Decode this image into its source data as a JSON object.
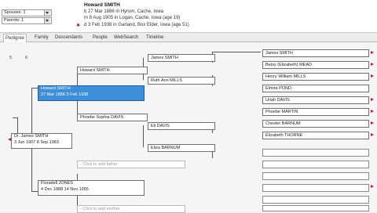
{
  "header": {
    "dropdowns": [
      "Spouses: 1",
      "Parents: 1"
    ],
    "person_name": "Howard SMITH",
    "facts": [
      "b 27 Mar 1886 in Hyrum, Cache, Iowa",
      "m 8 Aug 1905 in Logan, Cache, Iowa (age 19)",
      "d 3 Feb 1938 in Garland, Box Elder, Iowa (age 51)"
    ]
  },
  "tabs": [
    "Pedigree",
    "Family",
    "Descendants",
    "People",
    "WebSearch",
    "Timeline"
  ],
  "nav": {
    "a": "5",
    "b": "6"
  },
  "tree": {
    "focus": {
      "name": "Howard SMITH",
      "dates": "27 Mar 1886   3 Feb 1938"
    },
    "child": {
      "name": "Dr. James SMITH",
      "dates": "3 Jun 1907   8 Sep 1983"
    },
    "spouse": {
      "name": "Floradell JONES",
      "dates": "4 Dec 1888   14 Nov 1955"
    },
    "father": "Howard SMITH",
    "mother": "Phoebe Sophia DAVIS",
    "gp": [
      "James SMITH",
      "Ruth Ann MILLS",
      "Eli DAVIS",
      "Eliza BARNUM"
    ],
    "ggp": [
      "James SMITH",
      "Betsy (Elizabeth) MEAD",
      "Henry William MILLS",
      "Elmira POND",
      "Uriah DAVIS",
      "Phoebe MARTIN",
      "Chester BARNUM",
      "Elizabeth THORNE"
    ],
    "add_father": "- Click to add father",
    "add_mother": "- Click to add mother"
  }
}
